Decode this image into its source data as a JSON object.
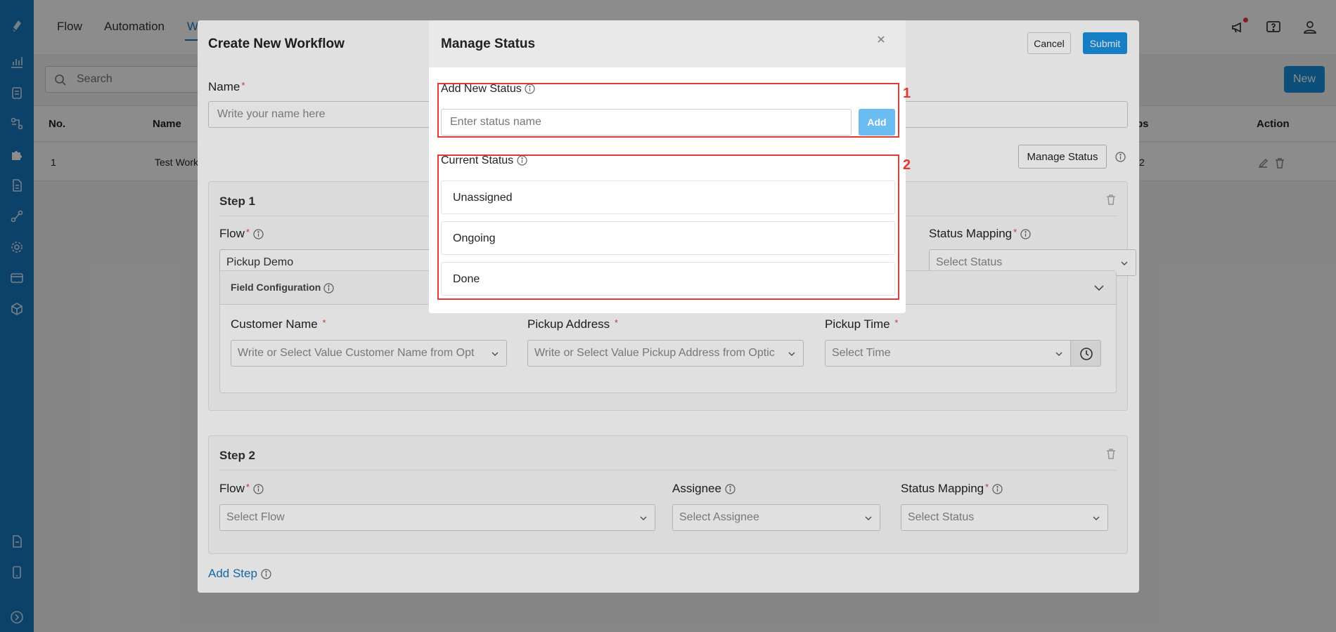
{
  "nav": {
    "tabs": [
      "Flow",
      "Automation",
      "W"
    ]
  },
  "search": {
    "placeholder": "Search"
  },
  "new_button": "New",
  "table": {
    "headers": [
      "No.",
      "Name",
      "ps",
      "Action"
    ],
    "rows": [
      {
        "no": "1",
        "name": "Test Work",
        "steps": "2"
      }
    ]
  },
  "workflow_modal": {
    "title": "Create New Workflow",
    "cancel": "Cancel",
    "submit": "Submit",
    "name_label": "Name",
    "required_mark": "*",
    "name_placeholder": "Write your name here",
    "manage_status_button": "Manage Status",
    "step1": {
      "title": "Step 1",
      "flow_label": "Flow",
      "flow_value": "Pickup Demo",
      "status_mapping_label": "Status Mapping",
      "status_placeholder": "Select Status",
      "field_config_title": "Field Configuration",
      "fields": [
        {
          "label": "Customer Name",
          "placeholder": "Write or Select Value Customer Name from Opt"
        },
        {
          "label": "Pickup Address",
          "placeholder": "Write or Select Value Pickup Address from Optic"
        },
        {
          "label": "Pickup Time",
          "placeholder": "Select Time"
        }
      ]
    },
    "step2": {
      "title": "Step 2",
      "flow_label": "Flow",
      "flow_placeholder": "Select Flow",
      "assignee_label": "Assignee",
      "assignee_placeholder": "Select Assignee",
      "status_mapping_label": "Status Mapping",
      "status_placeholder": "Select Status"
    },
    "add_step": "Add Step"
  },
  "manage_status_modal": {
    "title": "Manage Status",
    "add_label": "Add New Status",
    "input_placeholder": "Enter status name",
    "add_button": "Add",
    "current_label": "Current Status",
    "statuses": [
      "Unassigned",
      "Ongoing",
      "Done"
    ]
  },
  "annotations": {
    "box1": "1",
    "box2": "2",
    "color": "#e53935"
  },
  "colors": {
    "sidebar": "#1677c2",
    "primary": "#1890e0",
    "add_button": "#6bbcf0"
  }
}
